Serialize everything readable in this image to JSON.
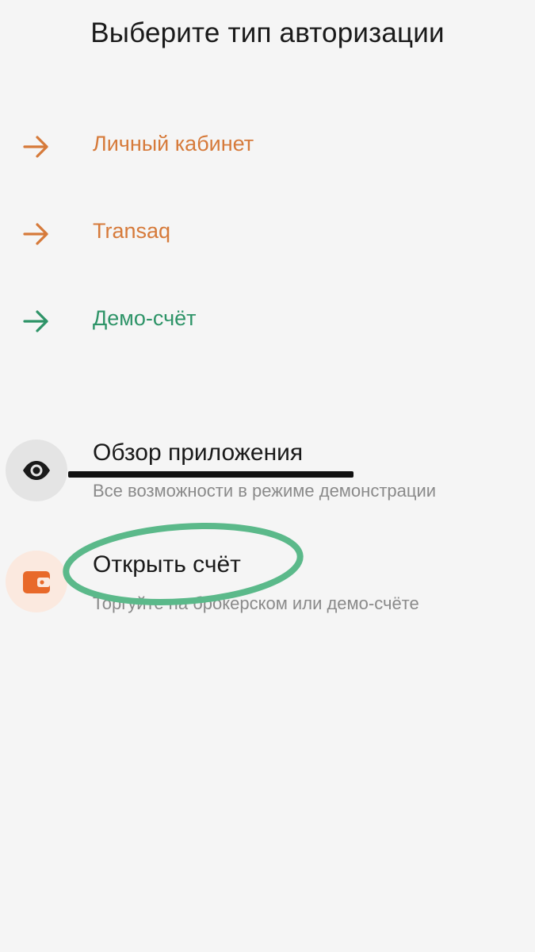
{
  "header": {
    "title": "Выберите тип авторизации"
  },
  "auth_options": [
    {
      "label": "Личный кабинет",
      "icon": "arrow-right-icon",
      "color": "#d67a3a"
    },
    {
      "label": "Transaq",
      "icon": "arrow-right-icon",
      "color": "#d67a3a"
    },
    {
      "label": "Демо-счёт",
      "icon": "arrow-right-icon",
      "color": "#2e9468"
    }
  ],
  "features": [
    {
      "title": "Обзор приложения",
      "subtitle": "Все возможности в режиме демонстрации",
      "icon": "eye-icon"
    },
    {
      "title": "Открыть счёт",
      "subtitle": "Торгуйте на брокерском или демо-счёте",
      "icon": "wallet-icon"
    }
  ],
  "colors": {
    "background": "#f5f5f5",
    "accent_orange": "#d67a3a",
    "accent_green": "#2e9468",
    "wallet_orange": "#e8692a",
    "annotation_green": "#5bb98a",
    "annotation_black": "#111111"
  }
}
